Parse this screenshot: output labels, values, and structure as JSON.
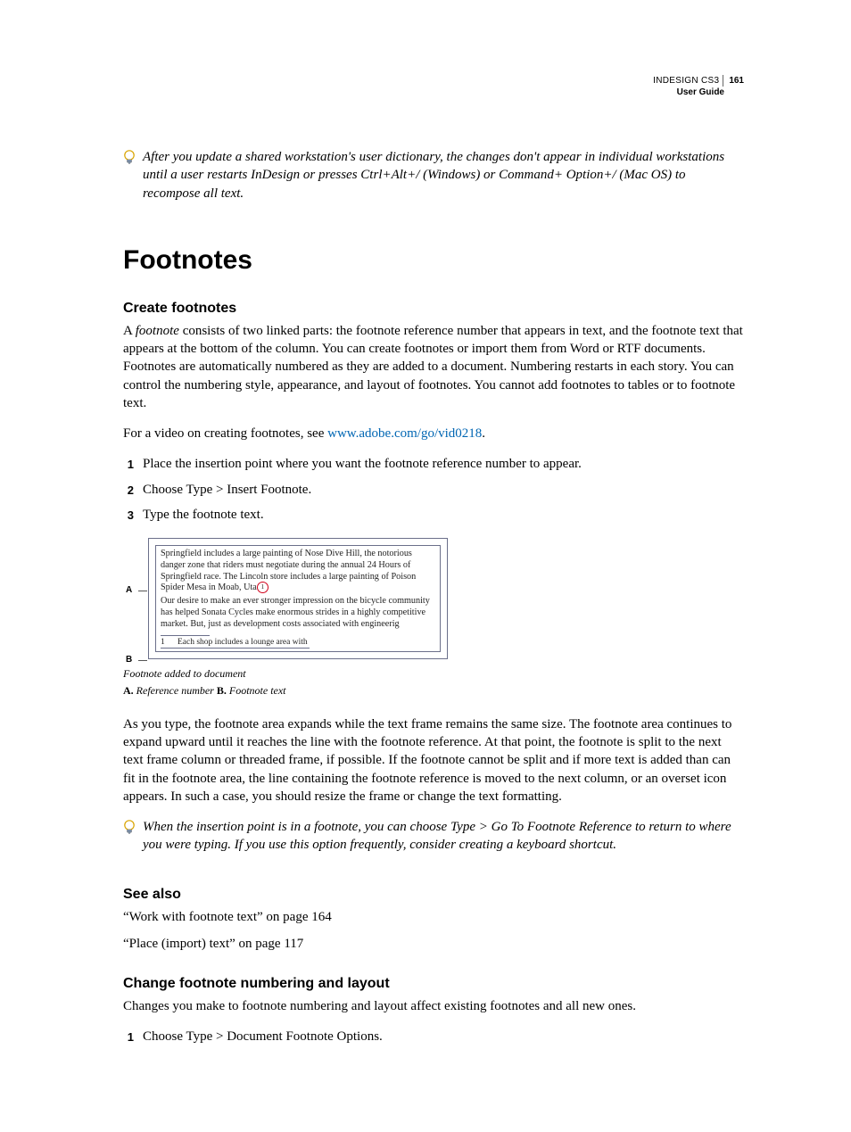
{
  "header": {
    "product": "INDESIGN CS3",
    "pageNumber": "161",
    "subtitle": "User Guide"
  },
  "tip1": "After you update a shared workstation's user dictionary, the changes don't appear in individual workstations until a user restarts InDesign or presses Ctrl+Alt+/ (Windows) or Command+ Option+/ (Mac OS) to recompose all text.",
  "section": {
    "title": "Footnotes",
    "create": {
      "heading": "Create footnotes",
      "para1_a": "A ",
      "para1_term": "footnote",
      "para1_b": " consists of two linked parts: the footnote reference number that appears in text, and the footnote text that appears at the bottom of the column. You can create footnotes or import them from Word or RTF documents. Footnotes are automatically numbered as they are added to a document. Numbering restarts in each story. You can control the numbering style, appearance, and layout of footnotes. You cannot add footnotes to tables or to footnote text.",
      "videoIntro": "For a video on creating footnotes, see ",
      "videoLinkText": "www.adobe.com/go/vid0218",
      "videoOutro": ".",
      "steps": [
        "Place the insertion point where you want the footnote reference number to appear.",
        "Choose Type > Insert Footnote.",
        "Type the footnote text."
      ],
      "figure": {
        "labelA": "A",
        "labelB": "B",
        "paraA": "Springfield includes a large painting of Nose Dive Hill, the notorious danger zone that riders must negotiate during the annual 24 Hours of Springfield race. The Lincoln store includes a large painting of Poison Spider Mesa in Moab, Uta",
        "refMark": "1",
        "paraB": "Our desire to make an ever stronger impression on the bicycle community has helped Sonata Cycles make enormous strides in a highly competitive market. But, just as development costs associated with engineerig",
        "footnoteNum": "1",
        "footnoteText": "Each shop includes a lounge area with",
        "caption": "Footnote added to document",
        "keyA_bold": "A.",
        "keyA_text": " Reference number  ",
        "keyB_bold": "B.",
        "keyB_text": " Footnote text"
      },
      "afterFigure": "As you type, the footnote area expands while the text frame remains the same size. The footnote area continues to expand upward until it reaches the line with the footnote reference. At that point, the footnote is split to the next text frame column or threaded frame, if possible. If the footnote cannot be split and if more text is added than can fit in the footnote area, the line containing the footnote reference is moved to the next column, or an overset icon appears. In such a case, you should resize the frame or change the text formatting.",
      "tip2": "When the insertion point is in a footnote, you can choose Type > Go To Footnote Reference to return to where you were typing. If you use this option frequently, consider creating a keyboard shortcut."
    },
    "seeAlso": {
      "heading": "See also",
      "items": [
        "“Work with footnote text” on page 164",
        "“Place (import) text” on page 117"
      ]
    },
    "change": {
      "heading": "Change footnote numbering and layout",
      "para": "Changes you make to footnote numbering and layout affect existing footnotes and all new ones.",
      "steps": [
        "Choose Type > Document Footnote Options."
      ]
    }
  }
}
